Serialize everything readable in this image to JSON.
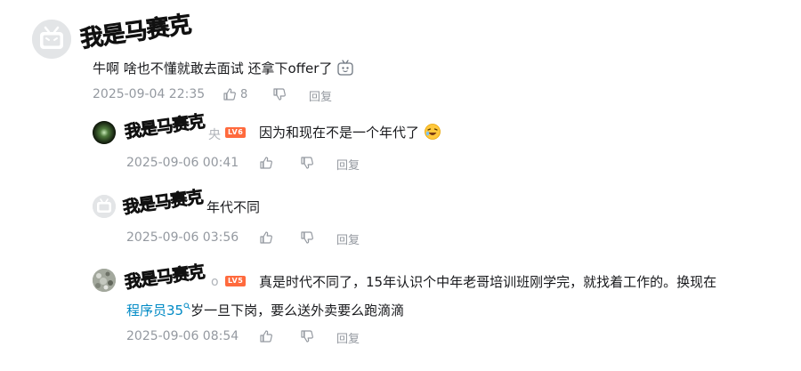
{
  "main_comment": {
    "user_sticker": "我是马赛克",
    "text": "牛啊 啥也不懂就敢去面试 还拿下offer了",
    "emoji_icon": "bilibili-tv-face-icon",
    "time": "2025-09-04 22:35",
    "likes": "8",
    "reply_label": "回复"
  },
  "replies": [
    {
      "user_sticker": "我是马赛克",
      "peek_char": "央",
      "level": "LV6",
      "text": "因为和现在不是一个年代了",
      "emoji_icon": "laughing-emoji-icon",
      "time": "2025-09-06 00:41",
      "reply_label": "回复"
    },
    {
      "user_sticker": "我是马赛克",
      "text": "年代不同",
      "time": "2025-09-06 03:56",
      "reply_label": "回复"
    },
    {
      "user_sticker": "我是马赛克",
      "peek_char": "o",
      "level": "LV5",
      "text_line1": "真是时代不同了，15年认识个中年老哥培训班刚学完，就找着工作的。换现在",
      "link_text": "程序员35",
      "text_line2_rest": "岁一旦下岗，要么送外卖要么跑滴滴",
      "time": "2025-09-06 08:54",
      "reply_label": "回复"
    }
  ],
  "colors": {
    "text": "#18191c",
    "meta": "#9499a0",
    "link": "#008ac5",
    "level_badge": "#ff6a3d"
  }
}
